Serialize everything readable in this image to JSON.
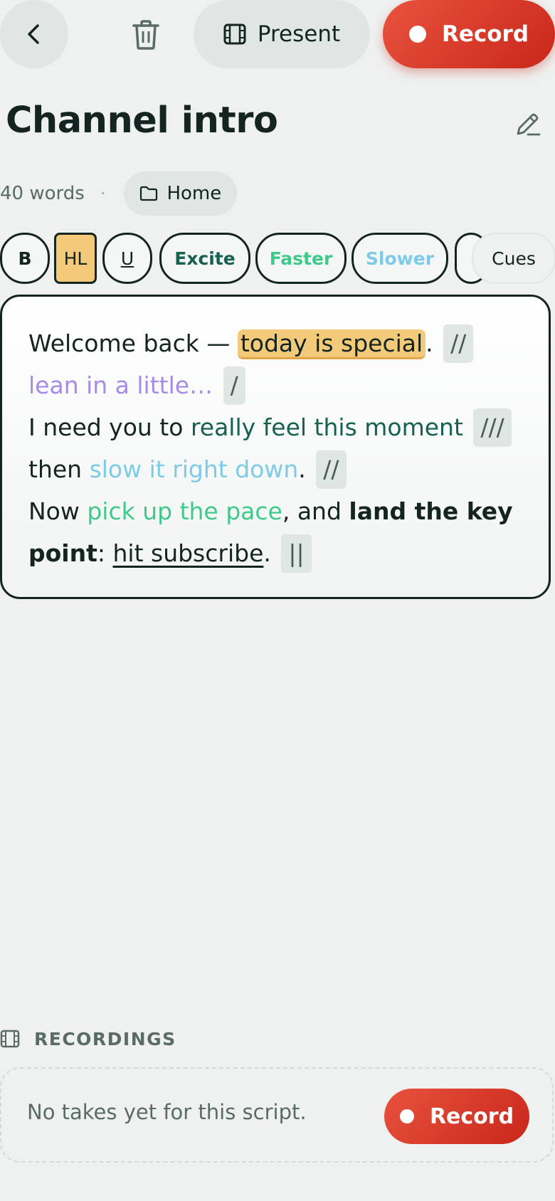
{
  "topbar": {
    "present_label": "Present",
    "record_label": "Record"
  },
  "script": {
    "title": "Channel intro",
    "word_count": "40 words",
    "separator": "·",
    "folder": "Home"
  },
  "toolbar": {
    "bold": "B",
    "highlight": "HL",
    "underline": "U",
    "excite": "Excite",
    "faster": "Faster",
    "slower": "Slower",
    "cues": "Cues"
  },
  "editor": {
    "s1": "Welcome back — ",
    "s2": "today is special",
    "s3": ".",
    "s4": "//",
    "s5": "lean in a little…",
    "s6": "/",
    "s7": "I need you to ",
    "s8": "really feel this moment",
    "s9": "///",
    "s10": "then ",
    "s11": "slow it right down",
    "s12": ".",
    "s13": "//",
    "s14": "Now ",
    "s15": "pick up the pace",
    "s16": ", and ",
    "s17": "land the key point",
    "s18": ": ",
    "s19": "hit subscribe",
    "s20": ".",
    "s21": "||"
  },
  "recordings": {
    "header": "RECORDINGS",
    "empty_text": "No takes yet for this script.",
    "record_label": "Record"
  },
  "colors": {
    "background": "#eef1f0",
    "record_red": "#e0402e",
    "highlight": "#f3c97a",
    "excite": "#17614f",
    "faster": "#3fc98b",
    "slower": "#7ecbe8",
    "lean": "#a68ce8",
    "pause_bg": "#dfe6e3"
  },
  "icons": {
    "back": "chevron-left-icon",
    "delete": "trash-icon",
    "present": "film-icon",
    "edit": "pencil-icon",
    "folder": "folder-icon",
    "recordings": "film-icon"
  }
}
